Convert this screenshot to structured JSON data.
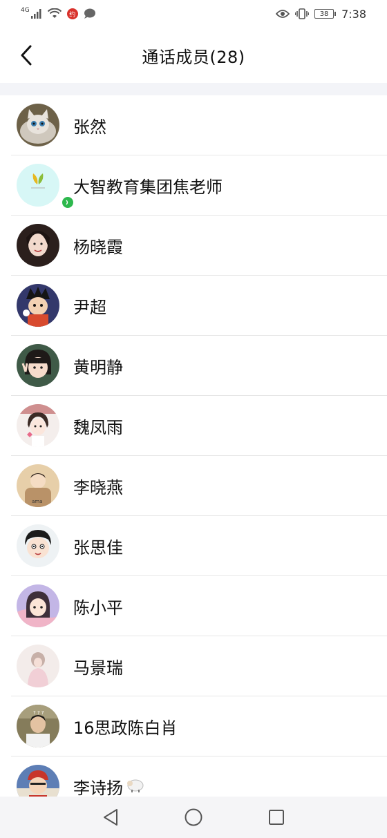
{
  "status_bar": {
    "network": "4G",
    "app_badge": "约",
    "battery": "38",
    "time": "7:38"
  },
  "header": {
    "title": "通话成员(28)"
  },
  "members": [
    {
      "name": "张然",
      "avatar": "cat-avatar"
    },
    {
      "name": "大智教育集团焦老师",
      "avatar": "leaf-logo-avatar",
      "speaking": true
    },
    {
      "name": "杨晓霞",
      "avatar": "portrait-avatar"
    },
    {
      "name": "尹超",
      "avatar": "anime-avatar"
    },
    {
      "name": "黄明静",
      "avatar": "child-avatar"
    },
    {
      "name": "魏凤雨",
      "avatar": "girl-avatar"
    },
    {
      "name": "李晓燕",
      "avatar": "toddler-avatar"
    },
    {
      "name": "张思佳",
      "avatar": "cartoon-avatar"
    },
    {
      "name": "陈小平",
      "avatar": "illustration-avatar"
    },
    {
      "name": "马景瑞",
      "avatar": "pink-avatar"
    },
    {
      "name": "16思政陈白肖",
      "avatar": "photo-avatar"
    },
    {
      "name": "李诗扬",
      "avatar": "red-cartoon-avatar",
      "suffix_icon": "sheep-emoji"
    }
  ],
  "nav": {
    "back": "back-triangle",
    "home": "home-circle",
    "recents": "recents-square"
  }
}
